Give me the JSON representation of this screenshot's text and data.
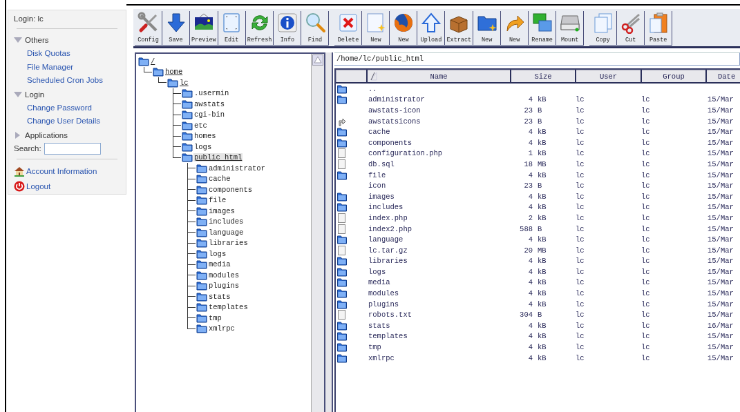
{
  "sidebar": {
    "login": "Login: lc",
    "sections": [
      {
        "title": "Others",
        "expanded": true,
        "items": [
          "Disk Quotas",
          "File Manager",
          "Scheduled Cron Jobs"
        ]
      },
      {
        "title": "Login",
        "expanded": true,
        "items": [
          "Change Password",
          "Change User Details"
        ]
      },
      {
        "title": "Applications",
        "expanded": false
      }
    ],
    "search": {
      "label": "Search:"
    },
    "links": [
      {
        "kind": "account",
        "label": "Account Information"
      },
      {
        "kind": "logout",
        "label": "Logout"
      }
    ]
  },
  "toolbar": [
    [
      {
        "kind": "config",
        "label": "Config"
      },
      {
        "kind": "save",
        "label": "Save"
      },
      {
        "kind": "preview",
        "label": "Preview"
      },
      {
        "kind": "edit",
        "label": "Edit"
      },
      {
        "kind": "refresh",
        "label": "Refresh"
      },
      {
        "kind": "info",
        "label": "Info"
      },
      {
        "kind": "find",
        "label": "Find"
      }
    ],
    [
      {
        "kind": "delete",
        "label": "Delete"
      },
      {
        "kind": "newfile",
        "label": "New"
      },
      {
        "kind": "globe",
        "label": "New"
      },
      {
        "kind": "upload",
        "label": "Upload"
      },
      {
        "kind": "extract",
        "label": "Extract"
      },
      {
        "kind": "newfolder",
        "label": "New"
      },
      {
        "kind": "newlink",
        "label": "New"
      },
      {
        "kind": "rename",
        "label": "Rename"
      },
      {
        "kind": "mount",
        "label": "Mount"
      }
    ],
    [
      {
        "kind": "copy",
        "label": "Copy"
      },
      {
        "kind": "cut",
        "label": "Cut"
      },
      {
        "kind": "paste",
        "label": "Paste"
      }
    ]
  ],
  "tree": [
    {
      "label": "/",
      "expanded": true,
      "selected": false,
      "children": [
        {
          "label": "home",
          "expanded": true,
          "selected": false,
          "children": [
            {
              "label": "lc",
              "expanded": true,
              "selected": false,
              "children": [
                {
                  "label": ".usermin",
                  "expanded": false,
                  "selected": false
                },
                {
                  "label": "awstats",
                  "expanded": false,
                  "selected": false
                },
                {
                  "label": "cgi-bin",
                  "expanded": false,
                  "selected": false
                },
                {
                  "label": "etc",
                  "expanded": false,
                  "selected": false
                },
                {
                  "label": "homes",
                  "expanded": false,
                  "selected": false
                },
                {
                  "label": "logs",
                  "expanded": false,
                  "selected": false
                },
                {
                  "label": "public html",
                  "expanded": true,
                  "selected": true,
                  "children": [
                    {
                      "label": "administrator",
                      "expanded": false,
                      "selected": false
                    },
                    {
                      "label": "cache",
                      "expanded": false,
                      "selected": false
                    },
                    {
                      "label": "components",
                      "expanded": false,
                      "selected": false
                    },
                    {
                      "label": "file",
                      "expanded": false,
                      "selected": false
                    },
                    {
                      "label": "images",
                      "expanded": false,
                      "selected": false
                    },
                    {
                      "label": "includes",
                      "expanded": false,
                      "selected": false
                    },
                    {
                      "label": "language",
                      "expanded": false,
                      "selected": false
                    },
                    {
                      "label": "libraries",
                      "expanded": false,
                      "selected": false
                    },
                    {
                      "label": "logs",
                      "expanded": false,
                      "selected": false
                    },
                    {
                      "label": "media",
                      "expanded": false,
                      "selected": false
                    },
                    {
                      "label": "modules",
                      "expanded": false,
                      "selected": false
                    },
                    {
                      "label": "plugins",
                      "expanded": false,
                      "selected": false
                    },
                    {
                      "label": "stats",
                      "expanded": false,
                      "selected": false
                    },
                    {
                      "label": "templates",
                      "expanded": false,
                      "selected": false
                    },
                    {
                      "label": "tmp",
                      "expanded": false,
                      "selected": false
                    },
                    {
                      "label": "xmlrpc",
                      "expanded": false,
                      "selected": false
                    }
                  ]
                }
              ]
            }
          ]
        }
      ]
    }
  ],
  "path": "/home/lc/public_html",
  "table": {
    "columns": [
      "Name",
      "Size",
      "User",
      "Group",
      "Date"
    ],
    "rows": [
      {
        "kind": "folder",
        "name": ".."
      },
      {
        "kind": "folder",
        "name": "administrator",
        "size": "4",
        "unit": "kB",
        "user": "lc",
        "group": "lc",
        "date": "15/Mar"
      },
      {
        "kind": "none",
        "name": "awstats-icon",
        "size": "23",
        "unit": "B",
        "user": "lc",
        "group": "lc",
        "date": "15/Mar"
      },
      {
        "kind": "link",
        "name": "awstatsicons",
        "size": "23",
        "unit": "B",
        "user": "lc",
        "group": "lc",
        "date": "15/Mar"
      },
      {
        "kind": "folder",
        "name": "cache",
        "size": "4",
        "unit": "kB",
        "user": "lc",
        "group": "lc",
        "date": "15/Mar"
      },
      {
        "kind": "folder",
        "name": "components",
        "size": "4",
        "unit": "kB",
        "user": "lc",
        "group": "lc",
        "date": "15/Mar"
      },
      {
        "kind": "file",
        "name": "configuration.php",
        "size": "1",
        "unit": "kB",
        "user": "lc",
        "group": "lc",
        "date": "15/Mar"
      },
      {
        "kind": "file",
        "name": "db.sql",
        "size": "18",
        "unit": "MB",
        "user": "lc",
        "group": "lc",
        "date": "15/Mar"
      },
      {
        "kind": "folder",
        "name": "file",
        "size": "4",
        "unit": "kB",
        "user": "lc",
        "group": "lc",
        "date": "15/Mar"
      },
      {
        "kind": "none",
        "name": "icon",
        "size": "23",
        "unit": "B",
        "user": "lc",
        "group": "lc",
        "date": "15/Mar"
      },
      {
        "kind": "folder",
        "name": "images",
        "size": "4",
        "unit": "kB",
        "user": "lc",
        "group": "lc",
        "date": "15/Mar"
      },
      {
        "kind": "folder",
        "name": "includes",
        "size": "4",
        "unit": "kB",
        "user": "lc",
        "group": "lc",
        "date": "15/Mar"
      },
      {
        "kind": "file",
        "name": "index.php",
        "size": "2",
        "unit": "kB",
        "user": "lc",
        "group": "lc",
        "date": "15/Mar"
      },
      {
        "kind": "file",
        "name": "index2.php",
        "size": "588",
        "unit": "B",
        "user": "lc",
        "group": "lc",
        "date": "15/Mar"
      },
      {
        "kind": "folder",
        "name": "language",
        "size": "4",
        "unit": "kB",
        "user": "lc",
        "group": "lc",
        "date": "15/Mar"
      },
      {
        "kind": "file",
        "name": "lc.tar.gz",
        "size": "20",
        "unit": "MB",
        "user": "lc",
        "group": "lc",
        "date": "15/Mar"
      },
      {
        "kind": "folder",
        "name": "libraries",
        "size": "4",
        "unit": "kB",
        "user": "lc",
        "group": "lc",
        "date": "15/Mar"
      },
      {
        "kind": "folder",
        "name": "logs",
        "size": "4",
        "unit": "kB",
        "user": "lc",
        "group": "lc",
        "date": "15/Mar"
      },
      {
        "kind": "folder",
        "name": "media",
        "size": "4",
        "unit": "kB",
        "user": "lc",
        "group": "lc",
        "date": "15/Mar"
      },
      {
        "kind": "folder",
        "name": "modules",
        "size": "4",
        "unit": "kB",
        "user": "lc",
        "group": "lc",
        "date": "15/Mar"
      },
      {
        "kind": "folder",
        "name": "plugins",
        "size": "4",
        "unit": "kB",
        "user": "lc",
        "group": "lc",
        "date": "15/Mar"
      },
      {
        "kind": "file",
        "name": "robots.txt",
        "size": "304",
        "unit": "B",
        "user": "lc",
        "group": "lc",
        "date": "15/Mar"
      },
      {
        "kind": "folder",
        "name": "stats",
        "size": "4",
        "unit": "kB",
        "user": "lc",
        "group": "lc",
        "date": "16/Mar"
      },
      {
        "kind": "folder",
        "name": "templates",
        "size": "4",
        "unit": "kB",
        "user": "lc",
        "group": "lc",
        "date": "15/Mar"
      },
      {
        "kind": "folder",
        "name": "tmp",
        "size": "4",
        "unit": "kB",
        "user": "lc",
        "group": "lc",
        "date": "15/Mar"
      },
      {
        "kind": "folder",
        "name": "xmlrpc",
        "size": "4",
        "unit": "kB",
        "user": "lc",
        "group": "lc",
        "date": "15/Mar"
      }
    ]
  }
}
